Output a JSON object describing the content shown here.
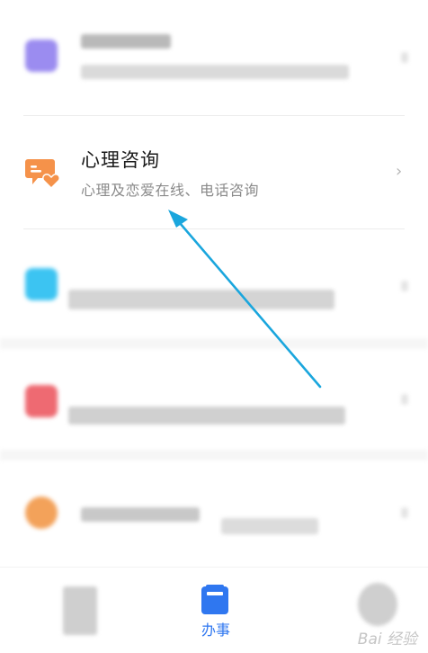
{
  "consult": {
    "title": "心理咨询",
    "subtitle": "心理及恋爱在线、电话咨询",
    "chevron": "›"
  },
  "tabbar": {
    "active_label": "办事"
  },
  "watermark": {
    "text": "Bai 经验"
  },
  "colors": {
    "accent": "#2f77f0",
    "consult_icon": "#f5924a",
    "arrow": "#1aa6dd"
  }
}
